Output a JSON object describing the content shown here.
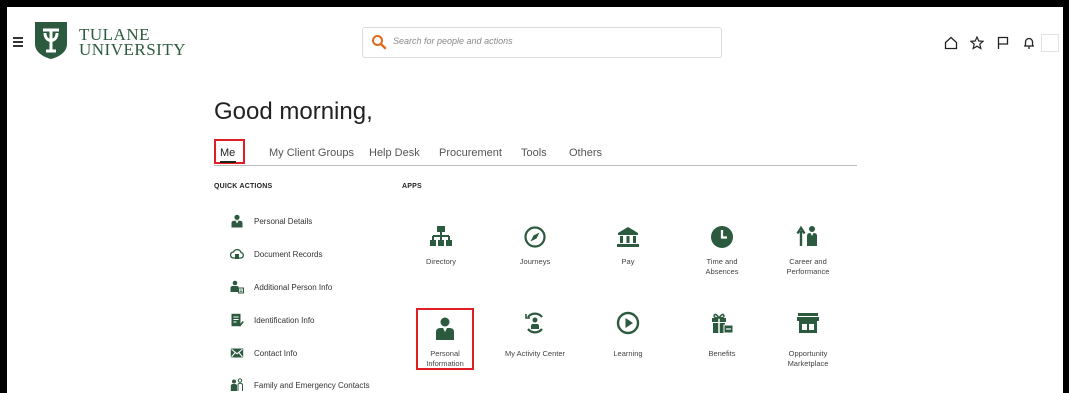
{
  "header": {
    "logo_line1": "TULANE",
    "logo_line2": "UNIVERSITY",
    "search_placeholder": "Search for people and actions",
    "icons": [
      "home-icon",
      "favorites-star-icon",
      "flag-icon",
      "notifications-bell-icon",
      "user-avatar"
    ]
  },
  "greeting": "Good morning,",
  "tabs": [
    "Me",
    "My Client Groups",
    "Help Desk",
    "Procurement",
    "Tools",
    "Others"
  ],
  "quick_actions": {
    "title": "QUICK ACTIONS",
    "items": [
      {
        "label": "Personal Details",
        "icon": "person-icon"
      },
      {
        "label": "Document Records",
        "icon": "cloud-document-icon"
      },
      {
        "label": "Additional Person Info",
        "icon": "person-card-icon"
      },
      {
        "label": "Identification Info",
        "icon": "id-document-icon"
      },
      {
        "label": "Contact Info",
        "icon": "envelope-icon"
      },
      {
        "label": "Family and Emergency Contacts",
        "icon": "family-icon"
      }
    ]
  },
  "apps": {
    "title": "APPS",
    "items": [
      {
        "label": "Directory",
        "icon": "org-chart-icon"
      },
      {
        "label": "Journeys",
        "icon": "compass-icon"
      },
      {
        "label": "Pay",
        "icon": "bank-icon"
      },
      {
        "label": "Time and Absences",
        "icon": "clock-icon"
      },
      {
        "label": "Career and Performance",
        "icon": "career-arrow-person-icon"
      },
      {
        "label": "Personal Information",
        "icon": "person-icon"
      },
      {
        "label": "My Activity Center",
        "icon": "activity-center-icon"
      },
      {
        "label": "Learning",
        "icon": "play-circle-icon"
      },
      {
        "label": "Benefits",
        "icon": "gift-icon"
      },
      {
        "label": "Opportunity Marketplace",
        "icon": "storefront-icon"
      }
    ]
  },
  "colors": {
    "brand_green": "#2b5a3e",
    "icon_green": "#2b5a3e",
    "highlight_red": "#e01e24",
    "search_orange": "#e26a1e"
  }
}
